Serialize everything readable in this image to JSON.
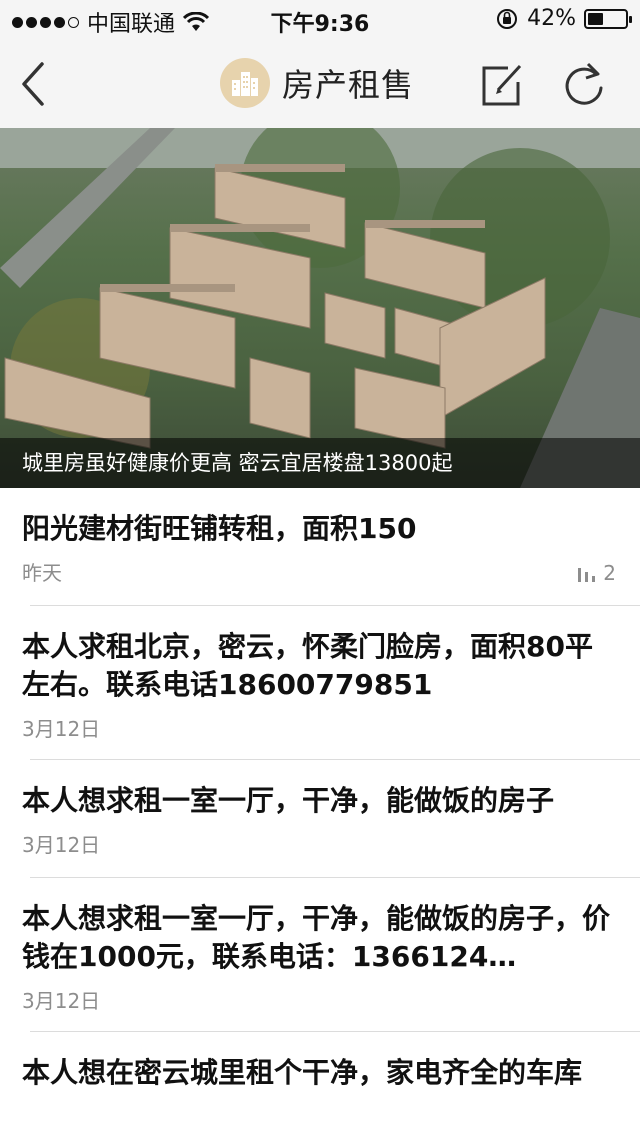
{
  "status_bar": {
    "carrier": "中国联通",
    "time": "下午9:36",
    "battery": "42%",
    "battery_level": 0.42
  },
  "nav": {
    "title": "房产租售",
    "icons": [
      "back-chevron-icon",
      "building-logo-icon",
      "edit-icon",
      "refresh-icon"
    ]
  },
  "banner": {
    "caption": "城里房虽好健康价更高 密云宜居楼盘13800起"
  },
  "list": [
    {
      "title": "阳光建材街旺铺转租，面积150",
      "date": "昨天",
      "views": "2"
    },
    {
      "title": "本人求租北京，密云，怀柔门脸房，面积80平左右。联系电话18600779851",
      "date": "3月12日"
    },
    {
      "title": "本人想求租一室一厅，干净，能做饭的房子",
      "date": "3月12日"
    },
    {
      "title": "本人想求租一室一厅，干净，能做饭的房子，价钱在1000元，联系电话：1366124…",
      "date": "3月12日"
    },
    {
      "title": "本人想在密云城里租个干净，家电齐全的车库",
      "date": ""
    }
  ]
}
